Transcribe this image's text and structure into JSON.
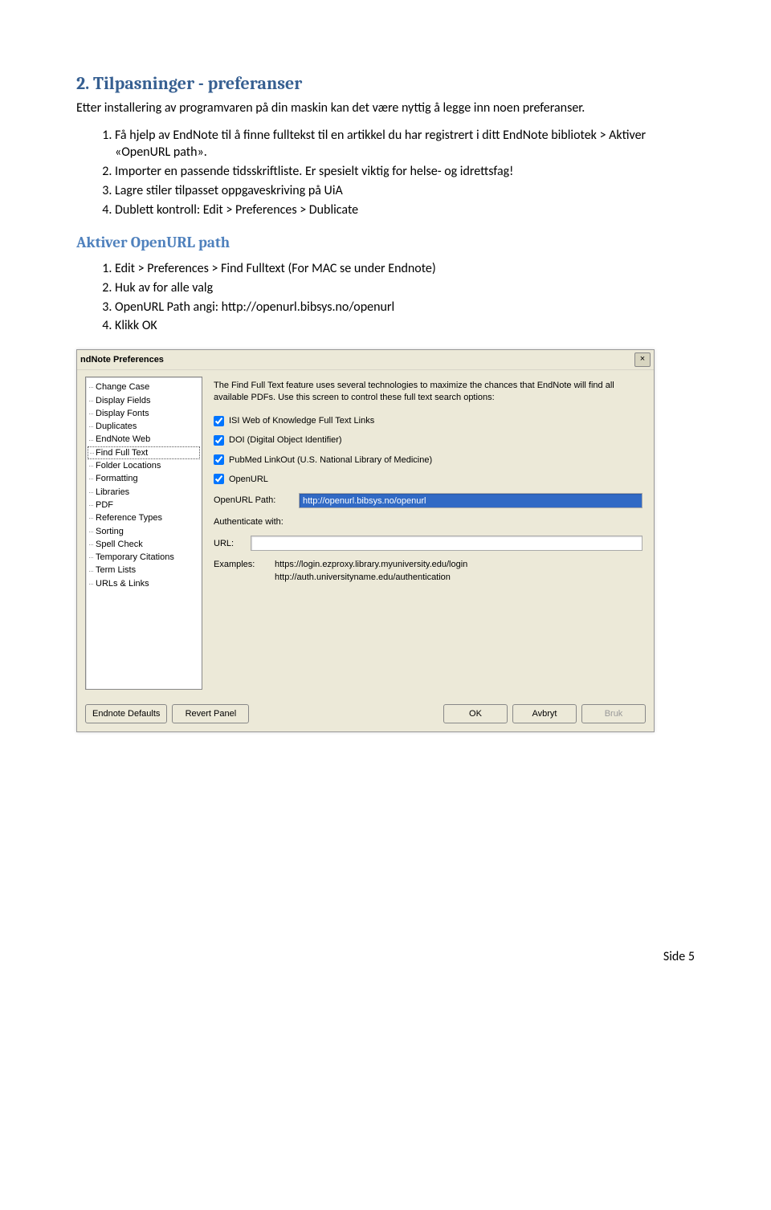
{
  "doc": {
    "section_title": "2.  Tilpasninger - preferanser",
    "intro": "Etter installering av programvaren på din maskin kan det være nyttig å legge inn noen preferanser.",
    "list1": [
      "Få hjelp av EndNote til å finne fulltekst til en artikkel du har registrert i ditt EndNote bibliotek > Aktiver «OpenURL path».",
      "Importer en passende tidsskriftliste. Er spesielt viktig for helse- og idrettsfag!",
      "Lagre stiler tilpasset oppgaveskriving på UiA",
      "Dublett kontroll: Edit > Preferences > Dublicate"
    ],
    "subheading": "Aktiver OpenURL path",
    "list2": [
      "Edit > Preferences > Find Fulltext (For MAC se under Endnote)",
      "Huk av for alle valg",
      "OpenURL Path angi: http://openurl.bibsys.no/openurl",
      "Klikk OK"
    ],
    "page_footer": "Side 5"
  },
  "dialog": {
    "title": "ndNote Preferences",
    "tree": [
      "Change Case",
      "Display Fields",
      "Display Fonts",
      "Duplicates",
      "EndNote Web",
      "Find Full Text",
      "Folder Locations",
      "Formatting",
      "Libraries",
      "PDF",
      "Reference Types",
      "Sorting",
      "Spell Check",
      "Temporary Citations",
      "Term Lists",
      "URLs & Links"
    ],
    "selected_index": 5,
    "description": "The Find Full Text feature uses several technologies to maximize the chances that EndNote will find all available PDFs. Use this screen to control these full text search options:",
    "checkboxes": [
      {
        "label": "ISI Web of Knowledge Full Text Links",
        "checked": true
      },
      {
        "label": "DOI (Digital Object Identifier)",
        "checked": true
      },
      {
        "label": "PubMed LinkOut (U.S. National Library of Medicine)",
        "checked": true
      },
      {
        "label": "OpenURL",
        "checked": true
      }
    ],
    "openurl_label": "OpenURL Path:",
    "openurl_value": "http://openurl.bibsys.no/openurl",
    "auth_label": "Authenticate with:",
    "url_label": "URL:",
    "url_value": "",
    "examples_label": "Examples:",
    "examples_line1": "https://login.ezproxy.library.myuniversity.edu/login",
    "examples_line2": "http://auth.universityname.edu/authentication",
    "buttons": {
      "defaults": "Endnote Defaults",
      "revert": "Revert Panel",
      "ok": "OK",
      "cancel": "Avbryt",
      "apply": "Bruk"
    }
  }
}
